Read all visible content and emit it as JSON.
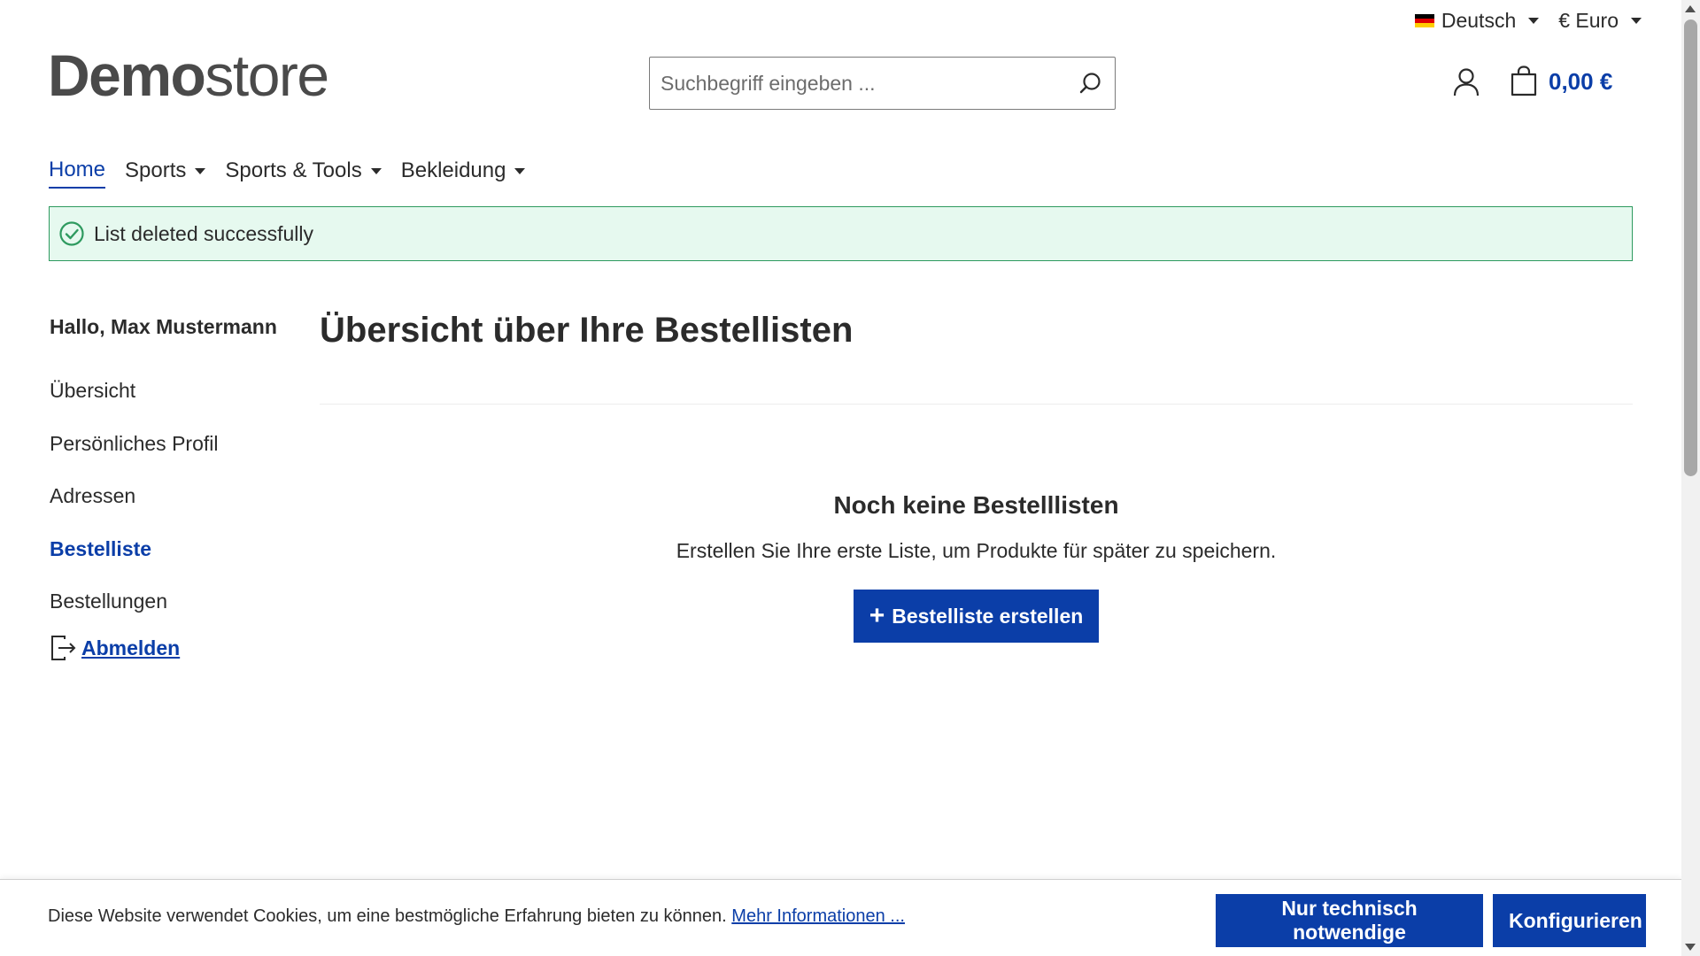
{
  "topbar": {
    "language": "Deutsch",
    "currency": "€ Euro"
  },
  "header": {
    "logo_bold": "Demo",
    "logo_light": "store",
    "search_placeholder": "Suchbegriff eingeben ...",
    "cart_total": "0,00 €"
  },
  "nav": {
    "items": [
      {
        "label": "Home",
        "active": true
      },
      {
        "label": "Sports",
        "dropdown": true
      },
      {
        "label": "Sports & Tools",
        "dropdown": true
      },
      {
        "label": "Bekleidung",
        "dropdown": true
      }
    ]
  },
  "alert": {
    "message": "List deleted successfully"
  },
  "sidebar": {
    "greeting": "Hallo, Max Mustermann",
    "items": [
      {
        "label": "Übersicht"
      },
      {
        "label": "Persönliches Profil"
      },
      {
        "label": "Adressen"
      },
      {
        "label": "Bestelliste",
        "active": true
      },
      {
        "label": "Bestellungen"
      }
    ],
    "logout": "Abmelden"
  },
  "main": {
    "title": "Übersicht über Ihre Bestellisten",
    "empty_title": "Noch keine Bestelllisten",
    "empty_text": "Erstellen Sie Ihre erste Liste, um Produkte für später zu speichern.",
    "create_button": "Bestelliste erstellen"
  },
  "cookie": {
    "text": "Diese Website verwendet Cookies, um eine bestmögliche Erfahrung bieten zu können.",
    "link": "Mehr Informationen ...",
    "btn_necessary": "Nur technisch notwendige",
    "btn_configure": "Konfigurieren"
  },
  "colors": {
    "primary": "#0b3ea8",
    "alert_bg": "#e6f9ef",
    "alert_border": "#2e9a5f",
    "text": "#2b2b2b"
  }
}
